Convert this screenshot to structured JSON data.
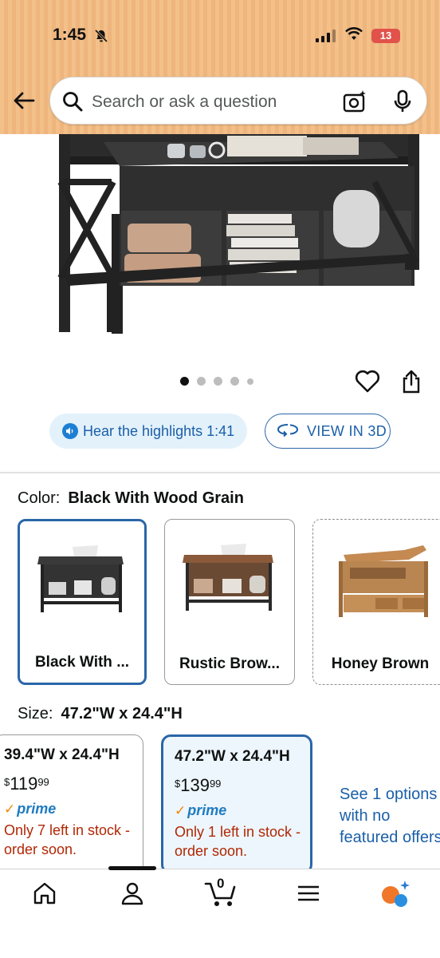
{
  "status_bar": {
    "time": "1:45",
    "battery": "13"
  },
  "search": {
    "placeholder": "Search or ask a question"
  },
  "carousel": {
    "total_dots": 5,
    "active_index": 0
  },
  "media_buttons": {
    "hear_label": "Hear the highlights 1:41",
    "view3d_label": "VIEW IN 3D"
  },
  "color": {
    "label": "Color:",
    "selected": "Black With Wood Grain",
    "options": [
      {
        "label": "Black With ...",
        "state": "selected"
      },
      {
        "label": "Rustic Brow...",
        "state": "available"
      },
      {
        "label": "Honey Brown",
        "state": "unavailable"
      }
    ]
  },
  "size": {
    "label": "Size:",
    "selected": "47.2\"W x 24.4\"H",
    "options": [
      {
        "title": "39.4\"W x 24.4\"H",
        "currency": "$",
        "dollars": "119",
        "cents": "99",
        "prime": "prime",
        "stock": "Only 7 left in stock - order soon."
      },
      {
        "title": "47.2\"W x 24.4\"H",
        "currency": "$",
        "dollars": "139",
        "cents": "99",
        "prime": "prime",
        "stock": "Only 1 left in stock - order soon."
      }
    ],
    "see_options": "See 1 options with no featured offers"
  },
  "bottom_nav": {
    "cart_count": "0",
    "items": [
      "home",
      "account",
      "cart",
      "menu",
      "rufus"
    ]
  },
  "colors": {
    "accent_blue": "#2a66a8",
    "stock_red": "#b12704",
    "prime_blue": "#1f7bc1",
    "header_bg": "#f3c08a"
  }
}
